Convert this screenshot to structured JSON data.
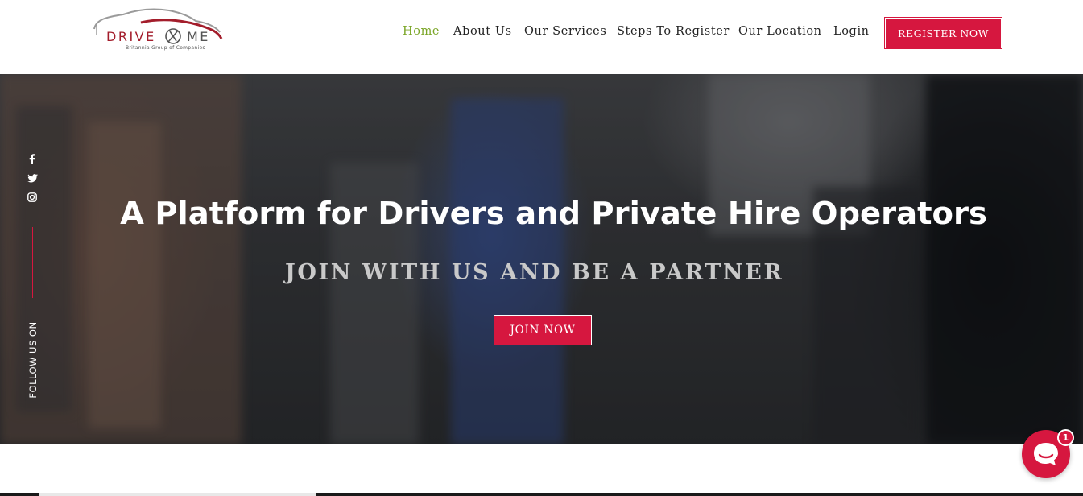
{
  "brand": {
    "logo_word_left": "DRIVE",
    "logo_word_right": "ME",
    "tagline": "Britannia Group of Companies"
  },
  "nav": {
    "items": [
      {
        "label": "Home",
        "active": true
      },
      {
        "label": "About Us",
        "active": false
      },
      {
        "label": "Our Services",
        "active": false
      },
      {
        "label": "Steps To Register",
        "active": false
      },
      {
        "label": "Our Location",
        "active": false
      },
      {
        "label": "Login",
        "active": false
      }
    ],
    "register_label": "REGISTER NOW"
  },
  "hero": {
    "title": "A Platform for Drivers and Private Hire Operators",
    "subtitle": "JOIN WITH US AND BE A PARTNER",
    "cta_label": "JOIN NOW"
  },
  "social": {
    "follow_label": "FOLLOW US ON",
    "icons": [
      "facebook-icon",
      "twitter-icon",
      "instagram-icon"
    ]
  },
  "chat": {
    "badge_count": "1"
  },
  "colors": {
    "accent": "#d6173f",
    "nav_active": "#7aa526",
    "logo_red": "#a31d2b"
  }
}
